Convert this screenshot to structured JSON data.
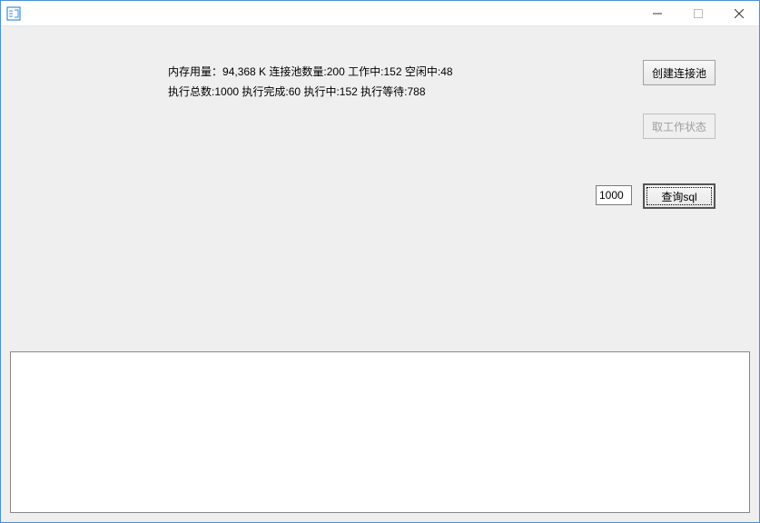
{
  "titlebar": {
    "title": ""
  },
  "status": {
    "mem_label": "内存用量：",
    "mem_value": "94,368 K",
    "pool_label": "连接池数量:",
    "pool_value": "200",
    "working_label": "工作中:",
    "working_value": "152",
    "idle_label": "空闲中:",
    "idle_value": "48",
    "exec_total_label": "执行总数:",
    "exec_total_value": "1000",
    "exec_done_label": "执行完成:",
    "exec_done_value": "60",
    "exec_running_label": "执行中:",
    "exec_running_value": "152",
    "exec_wait_label": "执行等待:",
    "exec_wait_value": "788"
  },
  "buttons": {
    "create_pool": "创建连接池",
    "get_status": "取工作状态",
    "query_sql": "查询sql"
  },
  "inputs": {
    "count_value": "1000"
  },
  "output": {
    "text": ""
  }
}
